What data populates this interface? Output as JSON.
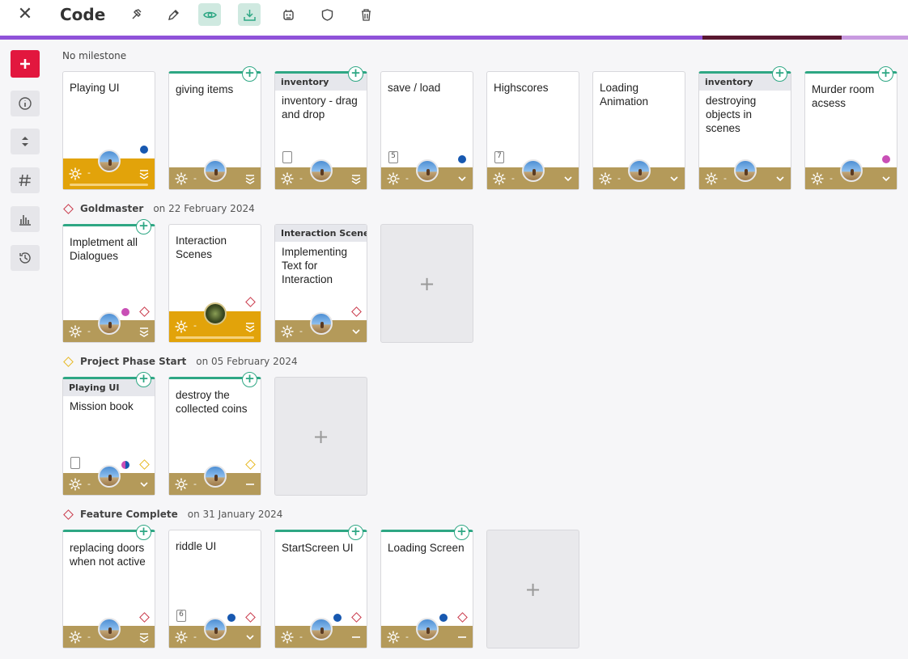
{
  "app": {
    "title": "Code"
  },
  "toolbar": [
    {
      "name": "hammer-icon",
      "active": false
    },
    {
      "name": "pencil-icon",
      "active": false
    },
    {
      "name": "eye-icon",
      "active": true
    },
    {
      "name": "download-tray-icon",
      "active": true
    },
    {
      "name": "robot-icon",
      "active": false
    },
    {
      "name": "shield-icon",
      "active": false
    },
    {
      "name": "trash-icon",
      "active": false
    }
  ],
  "progress_segments": [
    {
      "color": "#8f52d9",
      "fraction": 0.774
    },
    {
      "color": "#5a1830",
      "fraction": 0.153
    },
    {
      "color": "#c89ae0",
      "fraction": 0.073
    }
  ],
  "sidebar": [
    {
      "name": "add-icon"
    },
    {
      "name": "info-icon"
    },
    {
      "name": "sort-icon"
    },
    {
      "name": "hashtag-icon"
    },
    {
      "name": "chart-icon"
    },
    {
      "name": "history-icon"
    }
  ],
  "colors": {
    "blue_dot": "#1758b0",
    "pink_dot": "#c94fb6",
    "red_diamond": "#c9394a",
    "yellow_diamond": "#e8b923",
    "accent": "#2ea784",
    "footer": "#b49a5a",
    "footer_active": "#e2a30a"
  },
  "milestones": [
    {
      "label": "No milestone",
      "date": "",
      "diamond": "",
      "cards": [
        {
          "group": "",
          "title": "Playing UI",
          "plus": false,
          "foot": "big",
          "dots": [
            "blue"
          ],
          "diamond": "",
          "sub": "",
          "chev": "stack"
        },
        {
          "group": "",
          "title": "giving items",
          "plus": true,
          "foot": "normal",
          "dots": [],
          "diamond": "",
          "sub": "",
          "chev": "stack"
        },
        {
          "group": "inventory",
          "title": "inventory - drag and drop",
          "plus": true,
          "foot": "normal",
          "dots": [],
          "diamond": "",
          "sub": "",
          "subicon": true,
          "chev": "stack"
        },
        {
          "group": "",
          "title": "save / load",
          "plus": false,
          "foot": "normal",
          "dots": [
            "blue"
          ],
          "diamond": "",
          "sub": "5",
          "chev": "chevron"
        },
        {
          "group": "",
          "title": "Highscores",
          "plus": false,
          "foot": "normal",
          "dots": [],
          "diamond": "",
          "sub": "7",
          "chev": "chevron"
        },
        {
          "group": "",
          "title": "Loading Animation",
          "plus": false,
          "foot": "normal",
          "dots": [],
          "diamond": "",
          "sub": "",
          "chev": "chevron"
        },
        {
          "group": "inventory",
          "title": "destroying objects in scenes",
          "plus": true,
          "foot": "normal",
          "dots": [],
          "diamond": "",
          "sub": "",
          "chev": "chevron"
        },
        {
          "group": "",
          "title": "Murder room acsess",
          "plus": true,
          "foot": "normal",
          "dots": [
            "pink"
          ],
          "diamond": "",
          "sub": "",
          "chev": "chevron"
        }
      ]
    },
    {
      "label": "Goldmaster",
      "date": "on 22 February 2024",
      "diamond": "red",
      "cards": [
        {
          "group": "",
          "title": "Impletment all Dialogues",
          "plus": true,
          "foot": "normal",
          "dots": [
            "pink"
          ],
          "diamond": "red",
          "sub": "",
          "chev": "stack"
        },
        {
          "group": "",
          "title": "Interaction Scenes",
          "plus": false,
          "foot": "big",
          "dots": [],
          "diamond": "red",
          "sub": "",
          "chev": "stack",
          "avatar": "dark"
        },
        {
          "group": "Interaction Scenes",
          "title": "Implementing Text for Interaction",
          "plus": false,
          "foot": "normal",
          "dots": [],
          "diamond": "red",
          "sub": "",
          "chev": "chevron"
        }
      ]
    },
    {
      "label": "Project Phase Start",
      "date": "on 05 February 2024",
      "diamond": "yellow",
      "cards": [
        {
          "group": "Playing UI",
          "title": "Mission book",
          "plus": true,
          "foot": "normal",
          "dots": [
            "multi"
          ],
          "diamond": "yellow",
          "sub": "",
          "subicon": true,
          "chev": "chevron"
        },
        {
          "group": "",
          "title": "destroy the collected coins",
          "plus": true,
          "foot": "normal",
          "dots": [],
          "diamond": "yellow",
          "sub": "",
          "chev": "dash"
        }
      ]
    },
    {
      "label": "Feature Complete",
      "date": "on 31 January 2024",
      "diamond": "red",
      "cards": [
        {
          "group": "",
          "title": "replacing doors when not active",
          "plus": true,
          "foot": "normal",
          "dots": [],
          "diamond": "red",
          "sub": "",
          "chev": "stack"
        },
        {
          "group": "",
          "title": "riddle UI",
          "plus": false,
          "foot": "normal",
          "dots": [
            "blue"
          ],
          "diamond": "red",
          "sub": "6",
          "chev": "chevron"
        },
        {
          "group": "",
          "title": "StartScreen UI",
          "plus": true,
          "foot": "normal",
          "dots": [
            "blue"
          ],
          "diamond": "red",
          "sub": "",
          "chev": "dash"
        },
        {
          "group": "",
          "title": "Loading Screen",
          "plus": true,
          "foot": "normal",
          "dots": [
            "blue"
          ],
          "diamond": "red",
          "sub": "",
          "chev": "dash"
        }
      ]
    }
  ],
  "footer_text": "-",
  "add_symbol": "+"
}
